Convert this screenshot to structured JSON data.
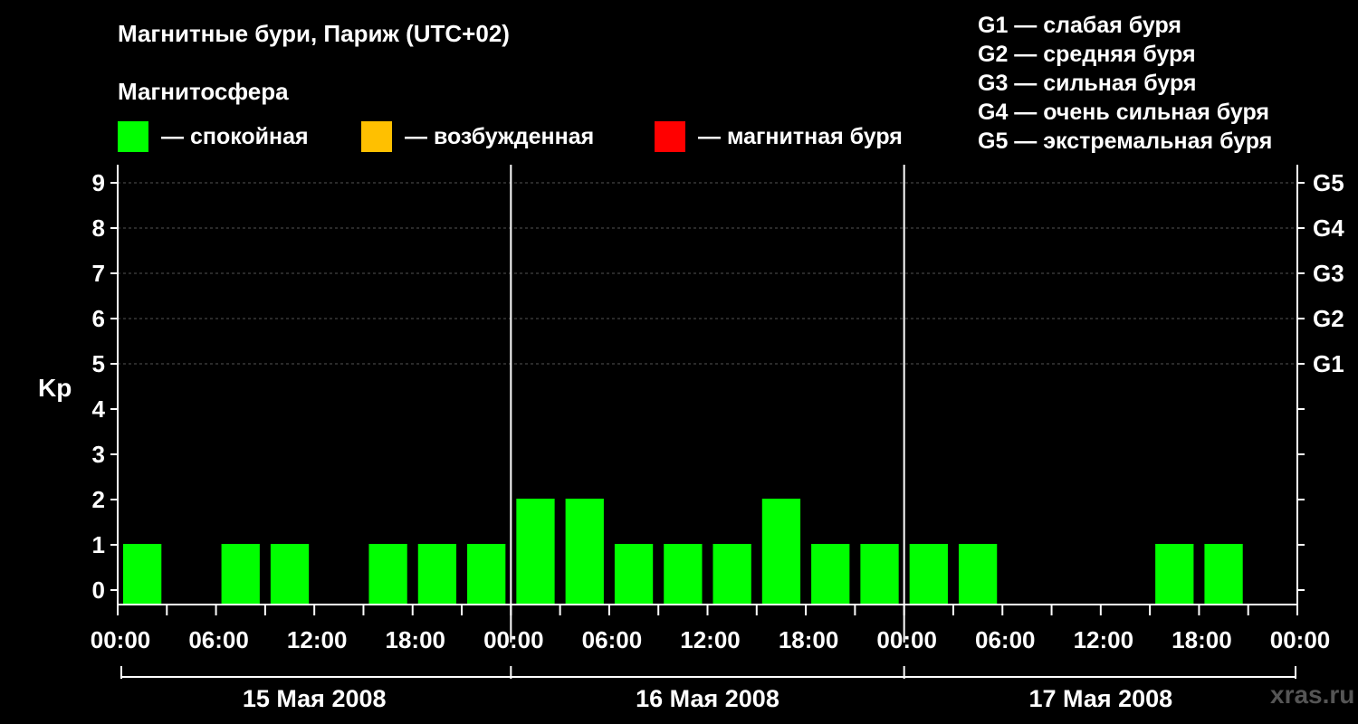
{
  "header": {
    "title": "Магнитные бури, Париж (UTC+02)",
    "subtitle": "Магнитосфера"
  },
  "legend": {
    "items": [
      {
        "label": "— спокойная",
        "color": "#00ff00"
      },
      {
        "label": "— возбужденная",
        "color": "#ffc000"
      },
      {
        "label": "— магнитная буря",
        "color": "#ff0000"
      }
    ]
  },
  "storm_levels": [
    "G1 — слабая буря",
    "G2 — средняя буря",
    "G3 — сильная буря",
    "G4 — очень сильная буря",
    "G5 — экстремальная буря"
  ],
  "watermark": "xras.ru",
  "chart_data": {
    "type": "bar",
    "ylabel": "Kp",
    "ylim": [
      0,
      9
    ],
    "y_ticks": [
      "0",
      "1",
      "2",
      "3",
      "4",
      "5",
      "6",
      "7",
      "8",
      "9"
    ],
    "right_axis_labels": [
      {
        "kp": 5,
        "label": "G1"
      },
      {
        "kp": 6,
        "label": "G2"
      },
      {
        "kp": 7,
        "label": "G3"
      },
      {
        "kp": 8,
        "label": "G4"
      },
      {
        "kp": 9,
        "label": "G5"
      }
    ],
    "x_tick_labels": [
      "00:00",
      "06:00",
      "12:00",
      "18:00",
      "00:00",
      "06:00",
      "12:00",
      "18:00",
      "00:00",
      "06:00",
      "12:00",
      "18:00",
      "00:00"
    ],
    "days": [
      "15 Мая 2008",
      "16 Мая 2008",
      "17 Мая 2008"
    ],
    "grid": true,
    "bar_color": "#00ff00",
    "series": [
      {
        "values": [
          [
            1,
            null,
            1,
            1,
            null,
            1,
            1,
            1
          ],
          [
            2,
            2,
            1,
            1,
            1,
            2,
            1,
            1
          ],
          [
            1,
            1,
            null,
            null,
            null,
            1,
            1,
            null
          ]
        ]
      }
    ]
  }
}
